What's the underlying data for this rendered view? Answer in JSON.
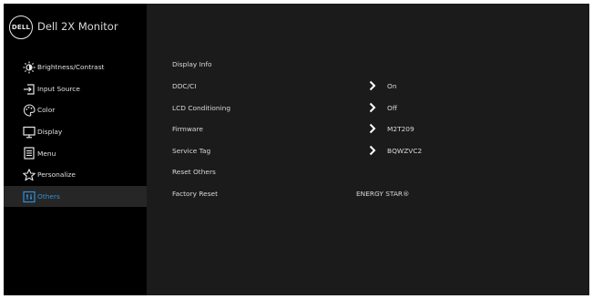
{
  "header": {
    "logo_text": "DELL",
    "title": "Dell 2X Monitor"
  },
  "sidebar": {
    "items": [
      {
        "label": "Brightness/Contrast",
        "icon": "brightness-icon"
      },
      {
        "label": "Input Source",
        "icon": "input-source-icon"
      },
      {
        "label": "Color",
        "icon": "color-palette-icon"
      },
      {
        "label": "Display",
        "icon": "display-icon"
      },
      {
        "label": "Menu",
        "icon": "menu-icon"
      },
      {
        "label": "Personalize",
        "icon": "star-icon"
      },
      {
        "label": "Others",
        "icon": "others-icon",
        "active": true
      }
    ]
  },
  "content": {
    "rows": [
      {
        "label": "Display Info"
      },
      {
        "label": "DDC/CI",
        "value": "On"
      },
      {
        "label": "LCD Conditioning",
        "value": "Off"
      },
      {
        "label": "Firmware",
        "value": "M2T209"
      },
      {
        "label": "Service Tag",
        "value": "BQWZVC2"
      },
      {
        "label": "Reset Others"
      },
      {
        "label": "Factory Reset",
        "note": "ENERGY STAR®"
      }
    ]
  },
  "colors": {
    "active_accent": "#2e8fd6",
    "sidebar_bg": "#000000",
    "content_bg": "#1b1b1b"
  }
}
